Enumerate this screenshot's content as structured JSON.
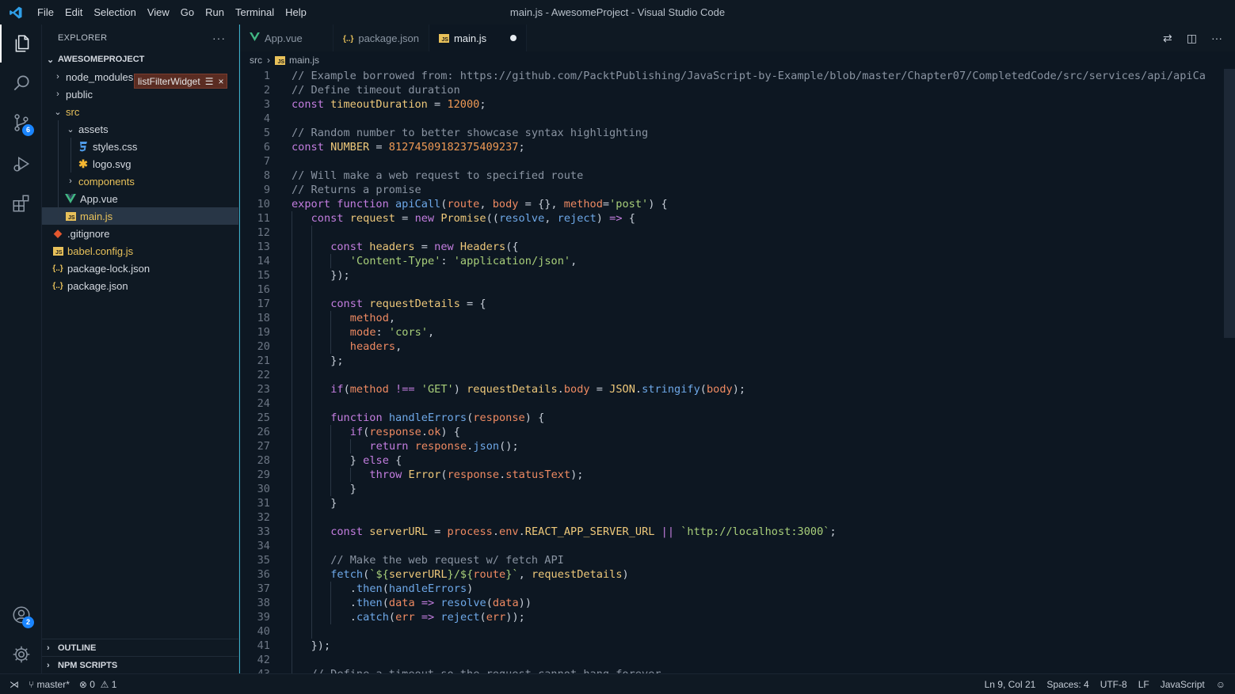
{
  "window": {
    "title": "main.js - AwesomeProject - Visual Studio Code"
  },
  "menu": [
    "File",
    "Edit",
    "Selection",
    "View",
    "Go",
    "Run",
    "Terminal",
    "Help"
  ],
  "activity": {
    "scm_badge": "6",
    "accounts_badge": "2"
  },
  "sidebar": {
    "title": "EXPLORER",
    "more": "···",
    "project": "AWESOMEPROJECT",
    "tree": [
      {
        "label": "node_modules",
        "depth": 0,
        "type": "folder",
        "expanded": false
      },
      {
        "label": "public",
        "depth": 0,
        "type": "folder",
        "expanded": false
      },
      {
        "label": "src",
        "depth": 0,
        "type": "folder",
        "expanded": true,
        "color": "yellow"
      },
      {
        "label": "assets",
        "depth": 1,
        "type": "folder",
        "expanded": true
      },
      {
        "label": "styles.css",
        "depth": 2,
        "type": "css"
      },
      {
        "label": "logo.svg",
        "depth": 2,
        "type": "svg"
      },
      {
        "label": "components",
        "depth": 1,
        "type": "folder",
        "expanded": false,
        "color": "yellow"
      },
      {
        "label": "App.vue",
        "depth": 1,
        "type": "vue"
      },
      {
        "label": "main.js",
        "depth": 1,
        "type": "js",
        "selected": true,
        "color": "yellow"
      },
      {
        "label": ".gitignore",
        "depth": 0,
        "type": "git"
      },
      {
        "label": "babel.config.js",
        "depth": 0,
        "type": "js",
        "color": "yellow"
      },
      {
        "label": "package-lock.json",
        "depth": 0,
        "type": "json"
      },
      {
        "label": "package.json",
        "depth": 0,
        "type": "json"
      }
    ],
    "widget": {
      "label": "listFilterWidget",
      "close": "×"
    },
    "outline": "OUTLINE",
    "npm_scripts": "NPM SCRIPTS"
  },
  "tabs": [
    {
      "label": "App.vue",
      "icon": "V",
      "active": false
    },
    {
      "label": "package.json",
      "icon": "{..}",
      "active": false
    },
    {
      "label": "main.js",
      "icon": "JS",
      "active": true,
      "modified": true
    }
  ],
  "breadcrumb": {
    "folder": "src",
    "file": "main.js"
  },
  "code": [
    {
      "n": "1",
      "indent": 0,
      "t": [
        [
          "cm",
          "// Example borrowed from: https://github.com/PacktPublishing/JavaScript-by-Example/blob/master/Chapter07/CompletedCode/src/services/api/apiCa"
        ]
      ]
    },
    {
      "n": "2",
      "indent": 0,
      "t": [
        [
          "cm",
          "// Define timeout duration"
        ]
      ]
    },
    {
      "n": "3",
      "indent": 0,
      "t": [
        [
          "kw",
          "const "
        ],
        [
          "var",
          "timeoutDuration"
        ],
        [
          "pl",
          " = "
        ],
        [
          "num",
          "12000"
        ],
        [
          "pl",
          ";"
        ]
      ]
    },
    {
      "n": "4",
      "indent": 0,
      "t": []
    },
    {
      "n": "5",
      "indent": 0,
      "t": [
        [
          "cm",
          "// Random number to better showcase syntax highlighting"
        ]
      ]
    },
    {
      "n": "6",
      "indent": 0,
      "t": [
        [
          "kw",
          "const "
        ],
        [
          "var",
          "NUMBER"
        ],
        [
          "pl",
          " = "
        ],
        [
          "num",
          "81274509182375409237"
        ],
        [
          "pl",
          ";"
        ]
      ]
    },
    {
      "n": "7",
      "indent": 0,
      "t": []
    },
    {
      "n": "8",
      "indent": 0,
      "t": [
        [
          "cm",
          "// Will make a web request to specified route"
        ]
      ]
    },
    {
      "n": "9",
      "indent": 0,
      "t": [
        [
          "cm",
          "// Returns a promise"
        ]
      ]
    },
    {
      "n": "10",
      "indent": 0,
      "t": [
        [
          "kw",
          "export function "
        ],
        [
          "fn",
          "apiCall"
        ],
        [
          "pl",
          "("
        ],
        [
          "par",
          "route"
        ],
        [
          "pl",
          ", "
        ],
        [
          "par",
          "body"
        ],
        [
          "pl",
          " = {}, "
        ],
        [
          "par",
          "method"
        ],
        [
          "pl",
          "="
        ],
        [
          "str",
          "'post'"
        ],
        [
          "pl",
          ") {"
        ]
      ]
    },
    {
      "n": "11",
      "indent": 1,
      "t": [
        [
          "kw",
          "const "
        ],
        [
          "var",
          "request"
        ],
        [
          "pl",
          " = "
        ],
        [
          "kw",
          "new "
        ],
        [
          "var",
          "Promise"
        ],
        [
          "pl",
          "(("
        ],
        [
          "fn",
          "resolve"
        ],
        [
          "pl",
          ", "
        ],
        [
          "fn",
          "reject"
        ],
        [
          "pl",
          ") "
        ],
        [
          "kw",
          "=>"
        ],
        [
          "pl",
          " {"
        ]
      ]
    },
    {
      "n": "12",
      "indent": 2,
      "t": []
    },
    {
      "n": "13",
      "indent": 2,
      "t": [
        [
          "kw",
          "const "
        ],
        [
          "var",
          "headers"
        ],
        [
          "pl",
          " = "
        ],
        [
          "kw",
          "new "
        ],
        [
          "var",
          "Headers"
        ],
        [
          "pl",
          "({"
        ]
      ]
    },
    {
      "n": "14",
      "indent": 3,
      "t": [
        [
          "str",
          "'Content-Type'"
        ],
        [
          "pl",
          ": "
        ],
        [
          "str",
          "'application/json'"
        ],
        [
          "pl",
          ","
        ]
      ]
    },
    {
      "n": "15",
      "indent": 2,
      "t": [
        [
          "pl",
          "});"
        ]
      ]
    },
    {
      "n": "16",
      "indent": 2,
      "t": []
    },
    {
      "n": "17",
      "indent": 2,
      "t": [
        [
          "kw",
          "const "
        ],
        [
          "var",
          "requestDetails"
        ],
        [
          "pl",
          " = {"
        ]
      ]
    },
    {
      "n": "18",
      "indent": 3,
      "t": [
        [
          "par",
          "method"
        ],
        [
          "pl",
          ","
        ]
      ]
    },
    {
      "n": "19",
      "indent": 3,
      "t": [
        [
          "par",
          "mode"
        ],
        [
          "pl",
          ": "
        ],
        [
          "str",
          "'cors'"
        ],
        [
          "pl",
          ","
        ]
      ]
    },
    {
      "n": "20",
      "indent": 3,
      "t": [
        [
          "par",
          "headers"
        ],
        [
          "pl",
          ","
        ]
      ]
    },
    {
      "n": "21",
      "indent": 2,
      "t": [
        [
          "pl",
          "};"
        ]
      ]
    },
    {
      "n": "22",
      "indent": 2,
      "t": []
    },
    {
      "n": "23",
      "indent": 2,
      "t": [
        [
          "kw",
          "if"
        ],
        [
          "pl",
          "("
        ],
        [
          "par",
          "method"
        ],
        [
          "pl",
          " "
        ],
        [
          "kw",
          "!=="
        ],
        [
          "pl",
          " "
        ],
        [
          "str",
          "'GET'"
        ],
        [
          "pl",
          ") "
        ],
        [
          "var",
          "requestDetails"
        ],
        [
          "pl",
          "."
        ],
        [
          "par",
          "body"
        ],
        [
          "pl",
          " = "
        ],
        [
          "var",
          "JSON"
        ],
        [
          "pl",
          "."
        ],
        [
          "fn",
          "stringify"
        ],
        [
          "pl",
          "("
        ],
        [
          "par",
          "body"
        ],
        [
          "pl",
          ");"
        ]
      ]
    },
    {
      "n": "24",
      "indent": 2,
      "t": []
    },
    {
      "n": "25",
      "indent": 2,
      "t": [
        [
          "kw",
          "function "
        ],
        [
          "fn",
          "handleErrors"
        ],
        [
          "pl",
          "("
        ],
        [
          "par",
          "response"
        ],
        [
          "pl",
          ") {"
        ]
      ]
    },
    {
      "n": "26",
      "indent": 3,
      "t": [
        [
          "kw",
          "if"
        ],
        [
          "pl",
          "("
        ],
        [
          "par",
          "response"
        ],
        [
          "pl",
          "."
        ],
        [
          "par",
          "ok"
        ],
        [
          "pl",
          ") {"
        ]
      ]
    },
    {
      "n": "27",
      "indent": 4,
      "t": [
        [
          "kw",
          "return "
        ],
        [
          "par",
          "response"
        ],
        [
          "pl",
          "."
        ],
        [
          "fn",
          "json"
        ],
        [
          "pl",
          "();"
        ]
      ]
    },
    {
      "n": "28",
      "indent": 3,
      "t": [
        [
          "pl",
          "} "
        ],
        [
          "kw",
          "else"
        ],
        [
          "pl",
          " {"
        ]
      ]
    },
    {
      "n": "29",
      "indent": 4,
      "t": [
        [
          "kw",
          "throw "
        ],
        [
          "var",
          "Error"
        ],
        [
          "pl",
          "("
        ],
        [
          "par",
          "response"
        ],
        [
          "pl",
          "."
        ],
        [
          "par",
          "statusText"
        ],
        [
          "pl",
          ");"
        ]
      ]
    },
    {
      "n": "30",
      "indent": 3,
      "t": [
        [
          "pl",
          "}"
        ]
      ]
    },
    {
      "n": "31",
      "indent": 2,
      "t": [
        [
          "pl",
          "}"
        ]
      ]
    },
    {
      "n": "32",
      "indent": 2,
      "t": []
    },
    {
      "n": "33",
      "indent": 2,
      "t": [
        [
          "kw",
          "const "
        ],
        [
          "var",
          "serverURL"
        ],
        [
          "pl",
          " = "
        ],
        [
          "par",
          "process"
        ],
        [
          "pl",
          "."
        ],
        [
          "par",
          "env"
        ],
        [
          "pl",
          "."
        ],
        [
          "var",
          "REACT_APP_SERVER_URL"
        ],
        [
          "pl",
          " "
        ],
        [
          "kw",
          "||"
        ],
        [
          "pl",
          " "
        ],
        [
          "str",
          "`http://localhost:3000`"
        ],
        [
          "pl",
          ";"
        ]
      ]
    },
    {
      "n": "34",
      "indent": 2,
      "t": []
    },
    {
      "n": "35",
      "indent": 2,
      "t": [
        [
          "cm",
          "// Make the web request w/ fetch API"
        ]
      ]
    },
    {
      "n": "36",
      "indent": 2,
      "t": [
        [
          "fn",
          "fetch"
        ],
        [
          "pl",
          "("
        ],
        [
          "str",
          "`${"
        ],
        [
          "var",
          "serverURL"
        ],
        [
          "str",
          "}/${"
        ],
        [
          "par",
          "route"
        ],
        [
          "str",
          "}`"
        ],
        [
          "pl",
          ", "
        ],
        [
          "var",
          "requestDetails"
        ],
        [
          "pl",
          ")"
        ]
      ]
    },
    {
      "n": "37",
      "indent": 3,
      "t": [
        [
          "pl",
          "."
        ],
        [
          "fn",
          "then"
        ],
        [
          "pl",
          "("
        ],
        [
          "fn",
          "handleErrors"
        ],
        [
          "pl",
          ")"
        ]
      ]
    },
    {
      "n": "38",
      "indent": 3,
      "t": [
        [
          "pl",
          "."
        ],
        [
          "fn",
          "then"
        ],
        [
          "pl",
          "("
        ],
        [
          "par",
          "data"
        ],
        [
          "pl",
          " "
        ],
        [
          "kw",
          "=>"
        ],
        [
          "pl",
          " "
        ],
        [
          "fn",
          "resolve"
        ],
        [
          "pl",
          "("
        ],
        [
          "par",
          "data"
        ],
        [
          "pl",
          "))"
        ]
      ]
    },
    {
      "n": "39",
      "indent": 3,
      "t": [
        [
          "pl",
          "."
        ],
        [
          "fn",
          "catch"
        ],
        [
          "pl",
          "("
        ],
        [
          "par",
          "err"
        ],
        [
          "pl",
          " "
        ],
        [
          "kw",
          "=>"
        ],
        [
          "pl",
          " "
        ],
        [
          "fn",
          "reject"
        ],
        [
          "pl",
          "("
        ],
        [
          "par",
          "err"
        ],
        [
          "pl",
          "));"
        ]
      ]
    },
    {
      "n": "40",
      "indent": 2,
      "t": []
    },
    {
      "n": "41",
      "indent": 1,
      "t": [
        [
          "pl",
          "});"
        ]
      ]
    },
    {
      "n": "42",
      "indent": 1,
      "t": []
    },
    {
      "n": "43",
      "indent": 1,
      "t": [
        [
          "cm",
          "// Define a timeout so the request cannot hang forever"
        ]
      ]
    }
  ],
  "status": {
    "branch": "master*",
    "errors": "0",
    "warnings": "1",
    "position": "Ln 9, Col 21",
    "spaces": "Spaces: 4",
    "encoding": "UTF-8",
    "eol": "LF",
    "language": "JavaScript"
  },
  "colors": {
    "accent": "#3cb0c9",
    "badge": "#1a85ff",
    "background": "#0d1722"
  }
}
